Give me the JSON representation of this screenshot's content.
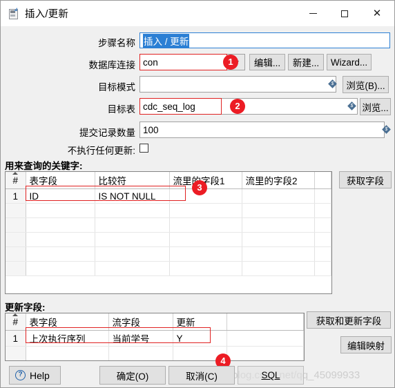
{
  "window": {
    "title": "插入/更新",
    "icon": "step-insert-update-icon",
    "controls": {
      "minimize": "—",
      "maximize": "□",
      "close": "✕"
    }
  },
  "form": {
    "step_name": {
      "label": "步骤名称",
      "value": "插入 / 更新",
      "selected": true
    },
    "db_connection": {
      "label": "数据库连接",
      "value": "con",
      "buttons": [
        "编辑...",
        "新建...",
        "Wizard..."
      ]
    },
    "target_schema": {
      "label": "目标模式",
      "value": "",
      "browse": "浏览(B)..."
    },
    "target_table": {
      "label": "目标表",
      "value": "cdc_seq_log",
      "browse": "浏览..."
    },
    "commit_size": {
      "label": "提交记录数量",
      "value": "100"
    },
    "no_update": {
      "label": "不执行任何更新:",
      "checked": false
    }
  },
  "lookup_section": {
    "title": "用来查询的关键字:",
    "columns": [
      "#",
      "表字段",
      "比较符",
      "流里的字段1",
      "流里的字段2"
    ],
    "rows": [
      {
        "idx": "1",
        "table_field": "ID",
        "comparator": "IS NOT NULL",
        "stream_field1": "",
        "stream_field2": ""
      },
      {
        "idx": "",
        "table_field": "",
        "comparator": "",
        "stream_field1": "",
        "stream_field2": ""
      },
      {
        "idx": "",
        "table_field": "",
        "comparator": "",
        "stream_field1": "",
        "stream_field2": ""
      },
      {
        "idx": "",
        "table_field": "",
        "comparator": "",
        "stream_field1": "",
        "stream_field2": ""
      },
      {
        "idx": "",
        "table_field": "",
        "comparator": "",
        "stream_field1": "",
        "stream_field2": ""
      },
      {
        "idx": "",
        "table_field": "",
        "comparator": "",
        "stream_field1": "",
        "stream_field2": ""
      }
    ],
    "get_fields_button": "获取字段"
  },
  "update_section": {
    "title": "更新字段:",
    "columns": [
      "#",
      "表字段",
      "流字段",
      "更新",
      ""
    ],
    "rows": [
      {
        "idx": "1",
        "table_field": "上次执行序列",
        "stream_field": "当前学号",
        "update": "Y",
        "blank": ""
      },
      {
        "idx": "",
        "table_field": "",
        "stream_field": "",
        "update": "",
        "blank": ""
      },
      {
        "idx": "",
        "table_field": "",
        "stream_field": "",
        "update": "",
        "blank": ""
      }
    ],
    "get_update_fields_button": "获取和更新字段",
    "edit_mapping_button": "编辑映射"
  },
  "footer": {
    "help": "Help",
    "ok": "确定(O)",
    "cancel": "取消(C)",
    "sql": "SQL"
  },
  "callouts": {
    "one": "1",
    "two": "2",
    "three": "3",
    "four": "4"
  },
  "watermark": "https://blog.csdn.net/qq_45099933",
  "colors": {
    "accent_red": "#ec1c24",
    "focus_blue": "#2b7fd4",
    "selection_blue": "#2b7fd4",
    "button_face": "#e1e1e1",
    "dialog_bg": "#f0f0f0"
  }
}
